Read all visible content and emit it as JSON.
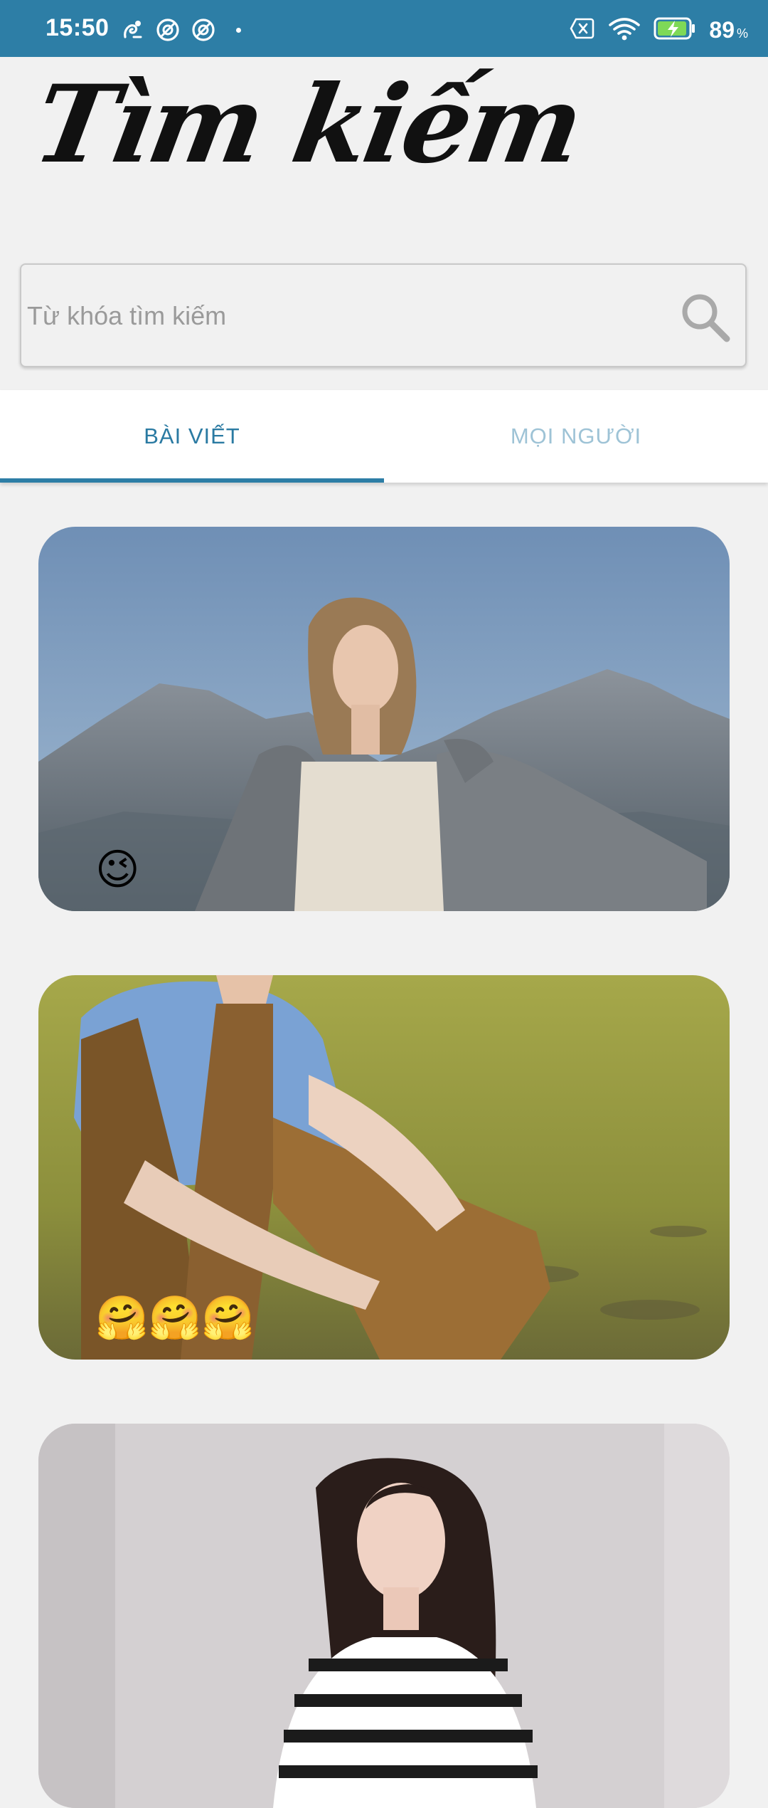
{
  "status_bar": {
    "time": "15:50",
    "battery_percent": "89",
    "battery_unit": "%",
    "icons_left": [
      "app-notification-icon",
      "vpn-icon",
      "vpn-icon",
      "dot-icon"
    ],
    "icons_right": [
      "no-sim-icon",
      "wifi-icon",
      "battery-charging-icon"
    ],
    "background_color": "#2d7ea6"
  },
  "header": {
    "title": "Tìm kiếm"
  },
  "search": {
    "placeholder": "Từ khóa tìm kiếm",
    "value": "",
    "icon": "search-icon"
  },
  "tabs": [
    {
      "label": "BÀI VIẾT",
      "active": true
    },
    {
      "label": "MỌI NGƯỜI",
      "active": false
    }
  ],
  "accent_color": "#2d7ea6",
  "posts": [
    {
      "caption": "😉",
      "image": "woman-mountains-photo"
    },
    {
      "caption": "🤗🤗🤗",
      "image": "person-grass-field-photo"
    },
    {
      "caption": "",
      "image": "woman-portrait-photo"
    }
  ]
}
